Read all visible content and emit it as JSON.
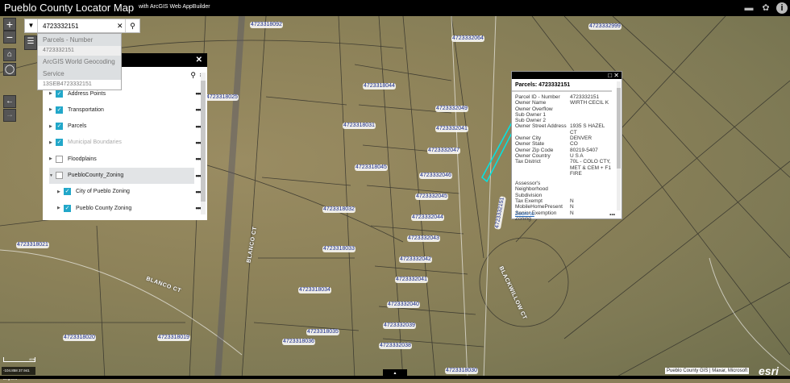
{
  "header": {
    "title": "Pueblo County Locator Map",
    "subtitle": "with ArcGIS Web AppBuilder"
  },
  "search": {
    "value": "4723332151",
    "suggestions": [
      {
        "type": "header",
        "text": "Parcels - Number"
      },
      {
        "type": "item",
        "text": "4723332151"
      },
      {
        "type": "header",
        "text": "ArcGIS World Geocoding"
      },
      {
        "type": "header",
        "text": "Service"
      },
      {
        "type": "item",
        "text": "13SEB4723332151"
      }
    ]
  },
  "layers": {
    "items": [
      {
        "label": "Address Points",
        "checked": true
      },
      {
        "label": "Transportation",
        "checked": true
      },
      {
        "label": "Parcels",
        "checked": true
      },
      {
        "label": "Municipal Boundaries",
        "checked": true,
        "dimmed": true
      },
      {
        "label": "Floodplains",
        "checked": false
      },
      {
        "label": "PuebloCounty_Zoning",
        "checked": false,
        "expanded": true
      },
      {
        "label": "City of Pueblo Zoning",
        "checked": true,
        "child": true
      },
      {
        "label": "Pueblo County Zoning",
        "checked": true,
        "child": true
      }
    ]
  },
  "popup": {
    "title": "Parcels: 4723332151",
    "fields": [
      [
        "Parcel ID - Number",
        "4723332151"
      ],
      [
        "Owner Name",
        "WIRTH CECIL K"
      ],
      [
        "Owner Overflow",
        ""
      ],
      [
        "Sub Owner 1",
        ""
      ],
      [
        "Sub Owner 2",
        ""
      ],
      [
        "Owner Street Address",
        "1935 S HAZEL CT"
      ],
      [
        "Owner City",
        "DENVER"
      ],
      [
        "Owner State",
        "CO"
      ],
      [
        "Owner Zip Code",
        "80219-5407"
      ],
      [
        "Owner Country",
        "U S A"
      ],
      [
        "Tax District",
        "70L - COLO CTY, MET & CEM + F1 FIRE"
      ],
      [
        "Assessor's Neighborhood",
        ""
      ],
      [
        "Subdivision",
        ""
      ],
      [
        "Tax Exempt",
        "N"
      ],
      [
        "MobileHomePresent",
        "N"
      ],
      [
        "Senior Exemption",
        "N"
      ],
      [
        "Zoning",
        ""
      ]
    ],
    "zoom_to": "Zoom to"
  },
  "map": {
    "parcels": [
      "4723318092",
      "4723332064",
      "4723332999",
      "4723318044",
      "4723318025",
      "4723332049",
      "4723318031",
      "4723332041",
      "4723332047",
      "4723318045",
      "4723332046",
      "4723332045",
      "4723318032",
      "4723332044",
      "4723332043",
      "4723318021",
      "4723318033",
      "4723332042",
      "4723332041",
      "4723318034",
      "4723332040",
      "4723332039",
      "4723318035",
      "4723318036",
      "4723318020",
      "4723318019",
      "4723332038",
      "4723318030",
      "4723332151"
    ],
    "streets": [
      "BLANCO CT",
      "BLANCO CT",
      "BLACKWILLOW CT"
    ],
    "coords": "-104.858 37.941 Degrees",
    "scale": "60ft",
    "attribution": "Pueblo County GIS | Maxar, Microsoft",
    "logo": "esri"
  },
  "colors": {
    "accent": "#22a7c9",
    "selection": "#00e5e5"
  }
}
